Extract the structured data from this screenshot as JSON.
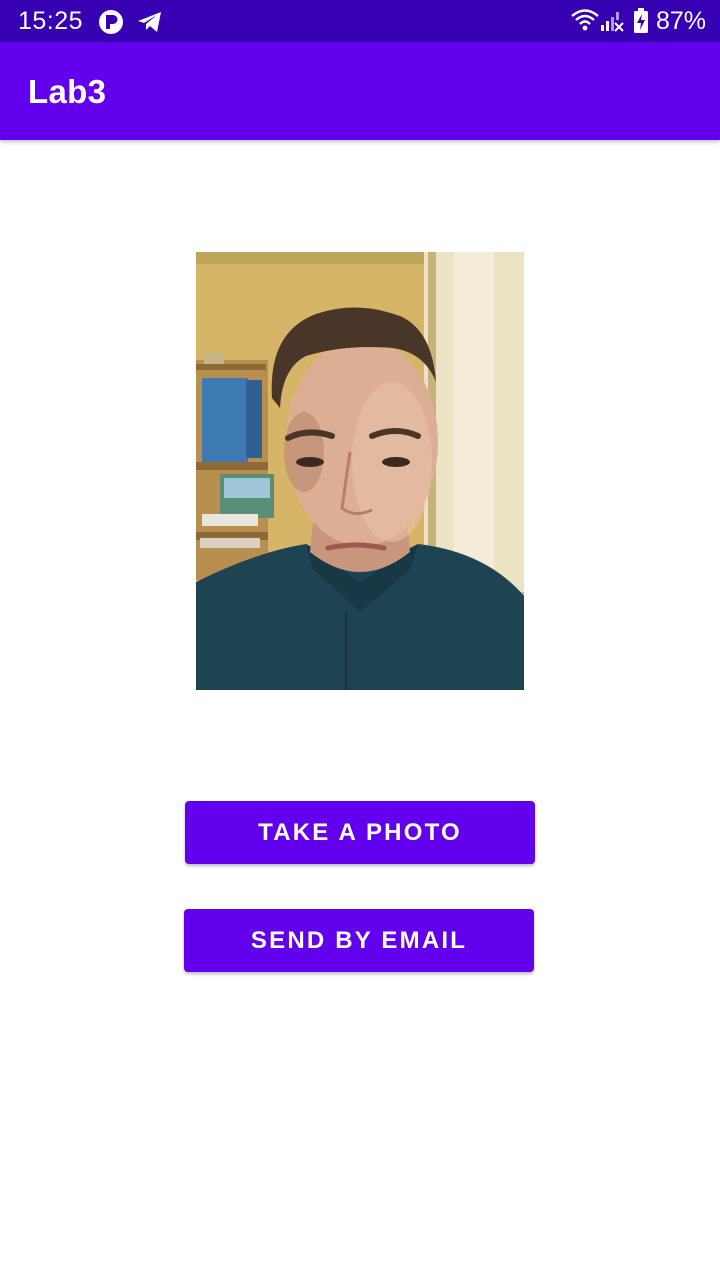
{
  "status_bar": {
    "time": "15:25",
    "battery": "87%",
    "icons": [
      "app-notification-icon",
      "telegram-icon",
      "wifi-icon",
      "signal-no-service-icon",
      "battery-charging-icon"
    ]
  },
  "app_bar": {
    "title": "Lab3"
  },
  "photo": {
    "description_icon": "selfie-photo"
  },
  "buttons": {
    "take_photo": "TAKE A PHOTO",
    "send_email": "SEND BY EMAIL"
  },
  "colors": {
    "status_bar": "#3700b3",
    "primary": "#6200ee",
    "on_primary": "#ffffff",
    "background": "#ffffff"
  }
}
